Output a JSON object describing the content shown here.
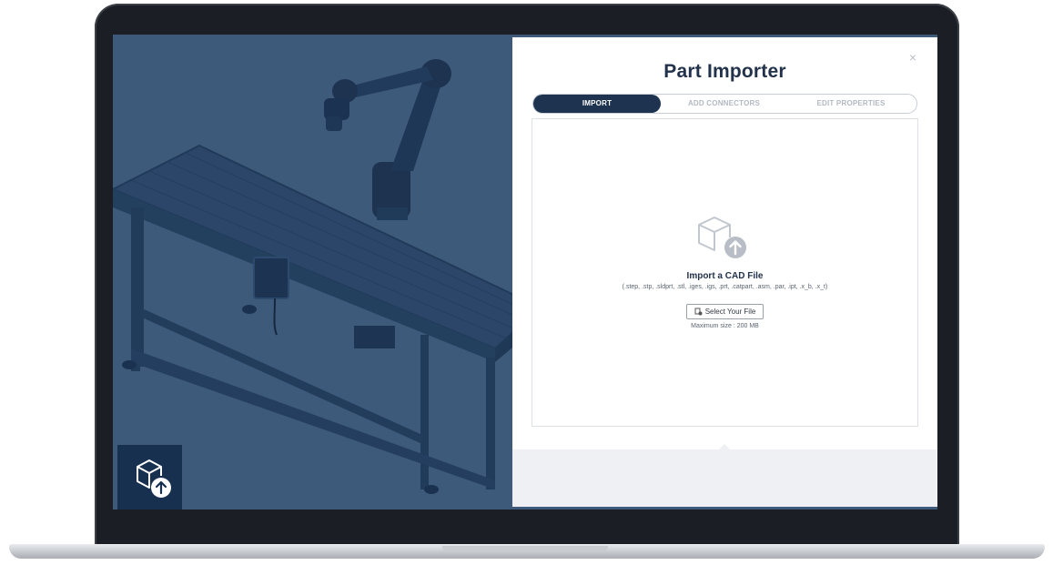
{
  "panel": {
    "title": "Part Importer",
    "close_icon": "×",
    "tabs": [
      {
        "label": "IMPORT",
        "active": true
      },
      {
        "label": "ADD CONNECTORS",
        "active": false
      },
      {
        "label": "EDIT PROPERTIES",
        "active": false
      }
    ]
  },
  "dropzone": {
    "heading": "Import a CAD File",
    "formats": "(.step, .stp, .sldprt, .stl, .iges, .igs, .prt, .catpart, .asm, .par, .ipt, .x_b, .x_t)",
    "select_label": "Select Your File",
    "max_size": "Maximum size : 200 MB",
    "icon": "cube-upload-icon"
  },
  "viewport": {
    "upload_tile_icon": "cube-upload-icon"
  },
  "colors": {
    "navy": "#1d3350",
    "scene_background": "#3e5a7a",
    "panel_footer": "#eef0f4"
  }
}
